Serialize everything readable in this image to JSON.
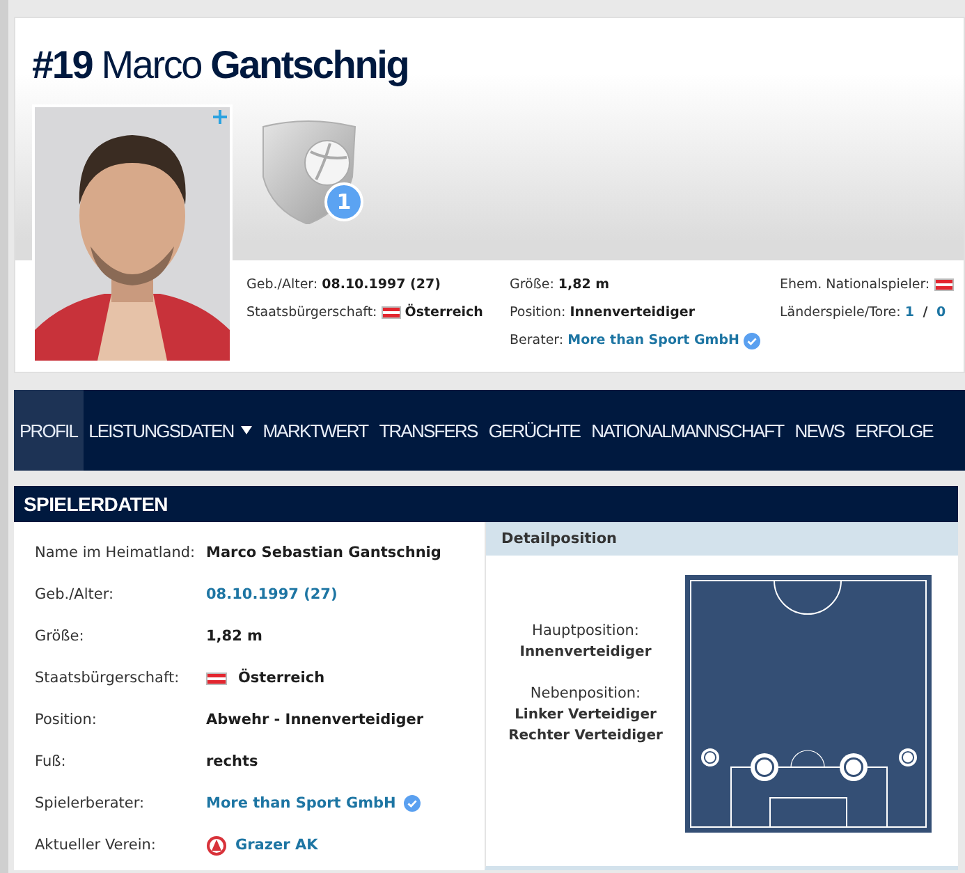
{
  "header": {
    "title": "**#19** Marco **Gantschnig**",
    "badge_count": "1",
    "info_columns": [
      [
        {
          "label": "Geb./Alter:",
          "value": "08.10.1997 (27)"
        },
        {
          "label": "Staatsbürgerschaft:",
          "value": "Österreich",
          "flag": true
        }
      ],
      [
        {
          "label": "Größe:",
          "value": "1,82 m"
        },
        {
          "label": "Position:",
          "value": "Innenverteidiger"
        },
        {
          "label": "Berater:",
          "value": "More than Sport GmbH",
          "link": true,
          "verified": true
        }
      ],
      [
        {
          "label": "Ehem. Nationalspieler:",
          "flag": true
        },
        {
          "label": "Länderspiele/Tore:",
          "parts": [
            {
              "text": "1",
              "link": true
            },
            {
              "text": " / ",
              "link": false
            },
            {
              "text": "0",
              "link": true
            }
          ]
        }
      ]
    ]
  },
  "nav": [
    {
      "label": "PROFIL",
      "selected": true
    },
    {
      "label": "LEISTUNGSDATEN",
      "selected": false,
      "has_menu": true
    },
    {
      "label": "MARKTWERT",
      "selected": false
    },
    {
      "label": "TRANSFERS",
      "selected": false
    },
    {
      "label": "GERÜCHTE",
      "selected": false
    },
    {
      "label": "NATIONALMANNSCHAFT",
      "selected": false
    },
    {
      "label": "NEWS",
      "selected": false
    },
    {
      "label": "ERFOLGE",
      "selected": false
    }
  ],
  "section": {
    "title": "SPIELERDATEN",
    "rows": [
      {
        "label": "Name im Heimatland:",
        "value": "Marco Sebastian Gantschnig"
      },
      {
        "label": "Geb./Alter:",
        "value": "08.10.1997 (27)",
        "link": true
      },
      {
        "label": "Größe:",
        "value": "1,82 m"
      },
      {
        "label": "Staatsbürgerschaft:",
        "value": "Österreich",
        "flag": true
      },
      {
        "label": "Position:",
        "value": "Abwehr - Innenverteidiger"
      },
      {
        "label": "Fuß:",
        "value": "rechts"
      },
      {
        "label": "Spielerberater:",
        "value": "More than Sport GmbH",
        "link": true,
        "verified": true
      },
      {
        "label": "Aktueller Verein:",
        "value": "Grazer AK",
        "link": true,
        "club_logo": true
      }
    ],
    "detail": {
      "title": "Detailposition",
      "main_label": "Hauptposition:",
      "main_values": [
        "Innenverteidiger"
      ],
      "secondary_label": "Nebenposition:",
      "secondary_values": [
        "Linker Verteidiger",
        "Rechter Verteidiger"
      ],
      "markers": [
        {
          "kind": "secondary"
        },
        {
          "kind": "main"
        },
        {
          "kind": "main"
        },
        {
          "kind": "secondary"
        }
      ]
    }
  }
}
